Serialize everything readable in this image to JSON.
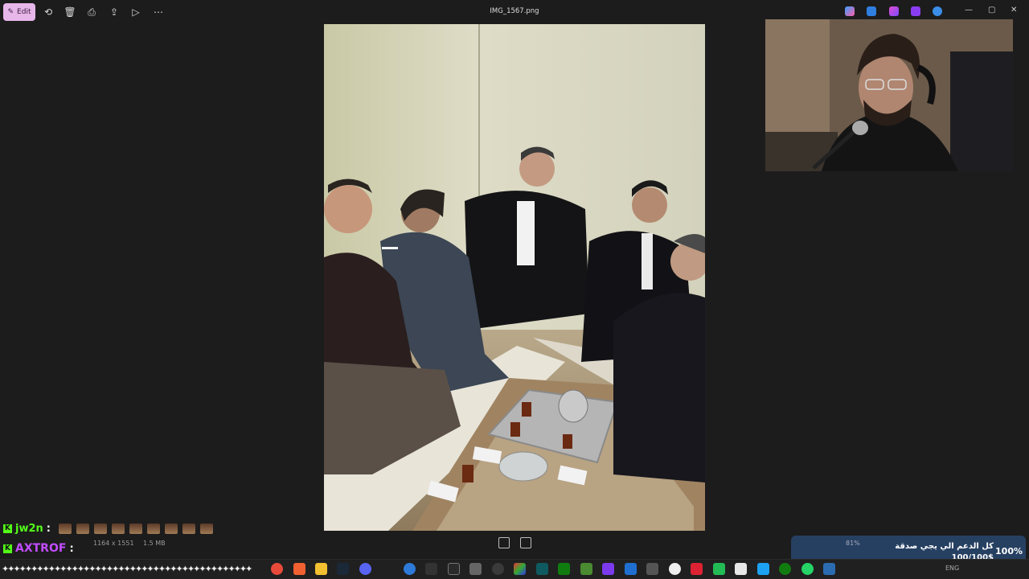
{
  "toolbar": {
    "edit_label": "Edit",
    "title": "IMG_1567.png"
  },
  "image_info": {
    "dimensions": "1164 x 1551",
    "file_size": "1.5 MB"
  },
  "chat": {
    "lines": [
      {
        "user": "jw2n",
        "sep": ":"
      },
      {
        "user": "AXTROF",
        "sep": ":"
      }
    ]
  },
  "donation": {
    "title": "كل الدعم الي يجي صدقة",
    "amount": "100/100$",
    "percent": "100%",
    "zoom": "81%"
  },
  "taskbar": {
    "language": "ENG"
  },
  "colors": {
    "accent_edit": "#e7b7ea",
    "kick_green": "#53fc18",
    "chat_purple": "#c24cff"
  }
}
